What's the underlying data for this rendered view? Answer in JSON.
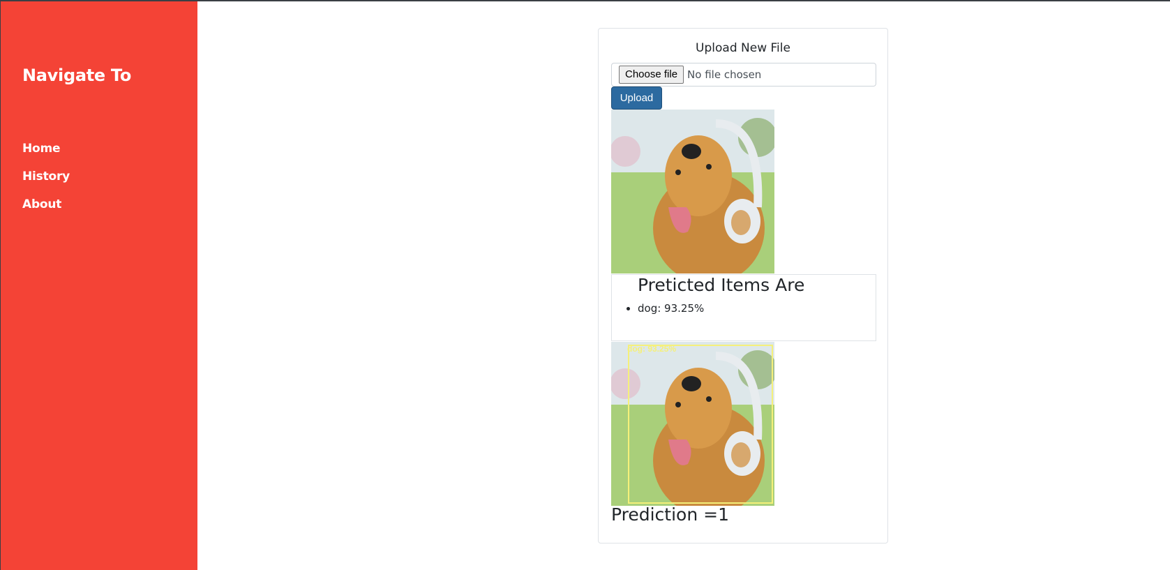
{
  "sidebar": {
    "title": "Navigate To",
    "items": [
      {
        "label": "Home"
      },
      {
        "label": "History"
      },
      {
        "label": "About"
      }
    ]
  },
  "upload": {
    "heading": "Upload New File",
    "choose_button": "Choose file",
    "file_status": "No file chosen",
    "upload_button": "Upload"
  },
  "results": {
    "title": "Preticted Items Are",
    "items": [
      "dog: 93.25%"
    ],
    "bbox_label": "dog: 93.25%"
  },
  "prediction": "Prediction =1",
  "colors": {
    "sidebar": "#f44336",
    "upload_button": "#2c6aa0",
    "bbox": "#f5f07a"
  }
}
